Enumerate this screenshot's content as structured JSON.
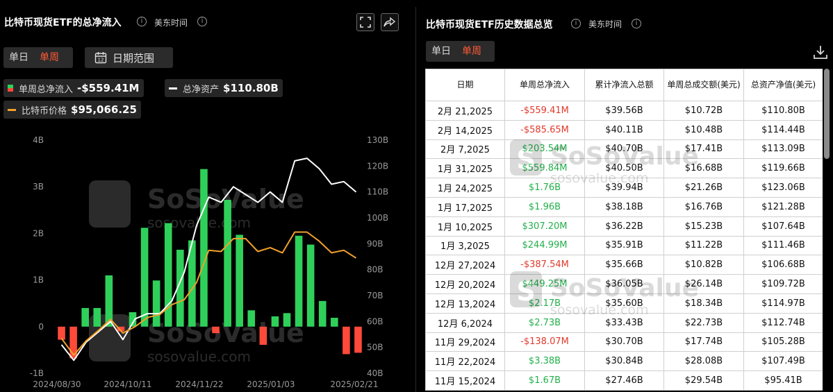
{
  "left": {
    "title": "比特币现货ETF的总净流入",
    "timezone": "美东时间",
    "tabs": {
      "daily": "单日",
      "weekly": "单周"
    },
    "range_label": "日期范围",
    "legend": {
      "net_inflow_label": "单周总净流入",
      "net_inflow_value": "-$559.41M",
      "assets_label": "总净资产",
      "assets_value": "$110.80B",
      "price_label": "比特币价格",
      "price_value": "$95,066.25"
    },
    "watermark": {
      "brand": "SoSoValue",
      "url": "sosovalue.com"
    }
  },
  "chart_data": {
    "type": "bar",
    "x_tick_labels": [
      "2024/08/30",
      "2024/10/11",
      "2024/11/22",
      "2025/01/03",
      "2025/02/21"
    ],
    "y_left_ticks": [
      "4B",
      "3B",
      "2B",
      "1B",
      "0",
      "-1B"
    ],
    "y_left_range": [
      -1,
      4
    ],
    "y_right_ticks": [
      "130B",
      "120B",
      "110B",
      "100B",
      "90B",
      "80B",
      "70B",
      "60B",
      "50B",
      "40B"
    ],
    "y_right_range": [
      40,
      130
    ],
    "series": [
      {
        "name": "单周总净流入",
        "unit": "B",
        "type": "bar",
        "values": [
          -0.28,
          -0.68,
          0.4,
          0.4,
          1.1,
          -0.1,
          0.31,
          2.12,
          0.99,
          2.22,
          1.65,
          1.85,
          3.38,
          -0.14,
          2.72,
          1.97,
          0.35,
          -0.39,
          0.22,
          0.29,
          1.95,
          1.76,
          0.55,
          0.19,
          -0.59,
          -0.56
        ]
      },
      {
        "name": "总净资产",
        "unit": "B",
        "type": "line",
        "color": "#ffffff",
        "values": [
          51,
          45,
          52,
          56,
          60,
          53,
          61,
          63,
          63,
          68,
          79,
          97,
          108,
          106,
          112,
          109,
          106,
          110,
          106,
          122,
          123,
          119,
          113,
          114,
          110
        ]
      },
      {
        "name": "比特币价格",
        "unit": "USD",
        "type": "line",
        "color": "#f2a12c",
        "values": [
          53500,
          47000,
          52500,
          56500,
          60800,
          55500,
          58000,
          61500,
          62700,
          66500,
          68400,
          75000,
          87500,
          87000,
          92000,
          92000,
          87000,
          88500,
          86500,
          94500,
          94500,
          91000,
          86500,
          87500,
          84500
        ]
      }
    ]
  },
  "right": {
    "title": "比特币现货ETF历史数据总览",
    "timezone": "美东时间",
    "tabs": {
      "daily": "单日",
      "weekly": "单周"
    },
    "columns": [
      "日期",
      "单周总净流入",
      "累计净流入总额",
      "单周总成交额(美元)",
      "总资产净值(美元)"
    ],
    "rows": [
      {
        "date": "2月 21,2025",
        "inflow": "-$559.41M",
        "cum": "$39.56B",
        "volume": "$10.72B",
        "nav": "$110.80B",
        "neg": true
      },
      {
        "date": "2月 14,2025",
        "inflow": "-$585.65M",
        "cum": "$40.11B",
        "volume": "$10.48B",
        "nav": "$114.44B",
        "neg": true
      },
      {
        "date": "2月 7,2025",
        "inflow": "$203.54M",
        "cum": "$40.70B",
        "volume": "$17.41B",
        "nav": "$113.09B",
        "neg": false
      },
      {
        "date": "1月 31,2025",
        "inflow": "$559.84M",
        "cum": "$40.50B",
        "volume": "$16.68B",
        "nav": "$119.66B",
        "neg": false
      },
      {
        "date": "1月 24,2025",
        "inflow": "$1.76B",
        "cum": "$39.94B",
        "volume": "$21.26B",
        "nav": "$123.06B",
        "neg": false
      },
      {
        "date": "1月 17,2025",
        "inflow": "$1.96B",
        "cum": "$38.18B",
        "volume": "$16.76B",
        "nav": "$121.28B",
        "neg": false
      },
      {
        "date": "1月 10,2025",
        "inflow": "$307.20M",
        "cum": "$36.22B",
        "volume": "$15.23B",
        "nav": "$107.64B",
        "neg": false
      },
      {
        "date": "1月 3,2025",
        "inflow": "$244.99M",
        "cum": "$35.91B",
        "volume": "$11.22B",
        "nav": "$111.46B",
        "neg": false
      },
      {
        "date": "12月 27,2024",
        "inflow": "-$387.54M",
        "cum": "$35.66B",
        "volume": "$10.82B",
        "nav": "$106.68B",
        "neg": true
      },
      {
        "date": "12月 20,2024",
        "inflow": "$449.25M",
        "cum": "$36.05B",
        "volume": "$26.14B",
        "nav": "$109.72B",
        "neg": false
      },
      {
        "date": "12月 13,2024",
        "inflow": "$2.17B",
        "cum": "$35.60B",
        "volume": "$18.34B",
        "nav": "$114.97B",
        "neg": false
      },
      {
        "date": "12月 6,2024",
        "inflow": "$2.73B",
        "cum": "$33.43B",
        "volume": "$22.73B",
        "nav": "$112.74B",
        "neg": false
      },
      {
        "date": "11月 29,2024",
        "inflow": "-$138.07M",
        "cum": "$30.70B",
        "volume": "$17.74B",
        "nav": "$105.28B",
        "neg": true
      },
      {
        "date": "11月 22,2024",
        "inflow": "$3.38B",
        "cum": "$30.84B",
        "volume": "$28.08B",
        "nav": "$107.49B",
        "neg": false
      },
      {
        "date": "11月 15,2024",
        "inflow": "$1.67B",
        "cum": "$27.46B",
        "volume": "$29.54B",
        "nav": "$95.41B",
        "neg": false
      }
    ],
    "watermark": {
      "brand": "SoSoValue",
      "url": "sosovalue.com"
    }
  }
}
